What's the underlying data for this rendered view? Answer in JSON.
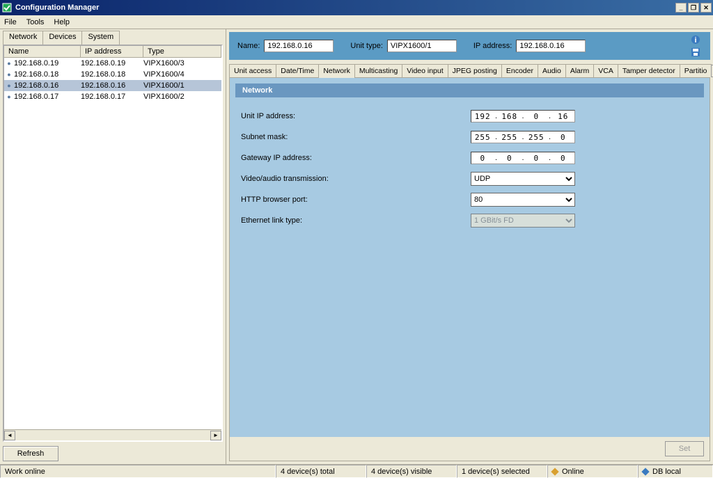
{
  "window": {
    "title": "Configuration Manager",
    "min": "_",
    "restore": "❐",
    "close": "✕"
  },
  "menu": {
    "file": "File",
    "tools": "Tools",
    "help": "Help"
  },
  "leftTabs": {
    "network": "Network",
    "devices": "Devices",
    "system": "System"
  },
  "deviceTable": {
    "headers": {
      "name": "Name",
      "ip": "IP address",
      "type": "Type"
    },
    "rows": [
      {
        "name": "192.168.0.19",
        "ip": "192.168.0.19",
        "type": "VIPX1600/3",
        "selected": false
      },
      {
        "name": "192.168.0.18",
        "ip": "192.168.0.18",
        "type": "VIPX1600/4",
        "selected": false
      },
      {
        "name": "192.168.0.16",
        "ip": "192.168.0.16",
        "type": "VIPX1600/1",
        "selected": true
      },
      {
        "name": "192.168.0.17",
        "ip": "192.168.0.17",
        "type": "VIPX1600/2",
        "selected": false
      }
    ]
  },
  "refreshBtn": "Refresh",
  "topInfo": {
    "nameLabel": "Name:",
    "nameValue": "192.168.0.16",
    "unitTypeLabel": "Unit type:",
    "unitTypeValue": "VIPX1600/1",
    "ipLabel": "IP address:",
    "ipValue": "192.168.0.16"
  },
  "rightTabs": [
    "Unit access",
    "Date/Time",
    "Network",
    "Multicasting",
    "Video input",
    "JPEG posting",
    "Encoder",
    "Audio",
    "Alarm",
    "VCA",
    "Tamper detector",
    "Partitio"
  ],
  "panel": {
    "title": "Network",
    "fields": {
      "unitIPLabel": "Unit IP address:",
      "unitIP": [
        "192",
        "168",
        "0",
        "16"
      ],
      "subnetLabel": "Subnet mask:",
      "subnet": [
        "255",
        "255",
        "255",
        "0"
      ],
      "gatewayLabel": "Gateway IP address:",
      "gateway": [
        "0",
        "0",
        "0",
        "0"
      ],
      "transLabel": "Video/audio transmission:",
      "transValue": "UDP",
      "httpLabel": "HTTP browser port:",
      "httpValue": "80",
      "ethLabel": "Ethernet link type:",
      "ethValue": "1 GBit/s FD"
    },
    "setBtn": "Set"
  },
  "status": {
    "work": "Work online",
    "total": "4 device(s) total",
    "visible": "4 device(s) visible",
    "selected": "1 device(s) selected",
    "online": "Online",
    "db": "DB local"
  }
}
